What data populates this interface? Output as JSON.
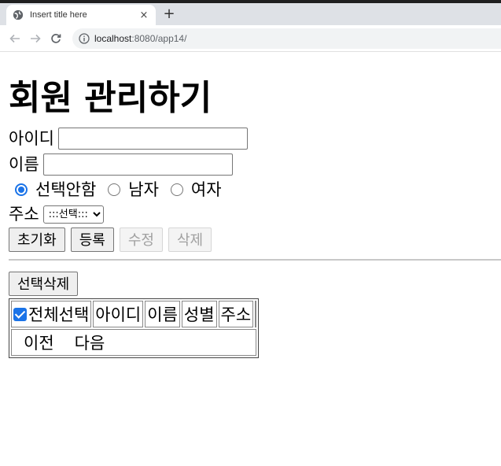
{
  "browser": {
    "tab_title": "Insert title here",
    "tab_close": "×",
    "new_tab": "+",
    "url_host": "localhost",
    "url_path": ":8080/app14/"
  },
  "page": {
    "title": "회원 관리하기"
  },
  "form": {
    "id_label": "아이디",
    "id_value": "",
    "name_label": "이름",
    "name_value": "",
    "gender_options": [
      {
        "label": "선택안함",
        "checked": true
      },
      {
        "label": "남자",
        "checked": false
      },
      {
        "label": "여자",
        "checked": false
      }
    ],
    "address_label": "주소",
    "address_selected": ":::선택:::"
  },
  "buttons": {
    "reset": "초기화",
    "register": "등록",
    "update": "수정",
    "delete": "삭제",
    "delete_selected": "선택삭제"
  },
  "table": {
    "headers": [
      "전체선택",
      "아이디",
      "이름",
      "성별",
      "주소"
    ],
    "select_all_checked": true,
    "pager_prev": "이전",
    "pager_next": "다음"
  },
  "colors": {
    "accent": "#1a73e8"
  }
}
